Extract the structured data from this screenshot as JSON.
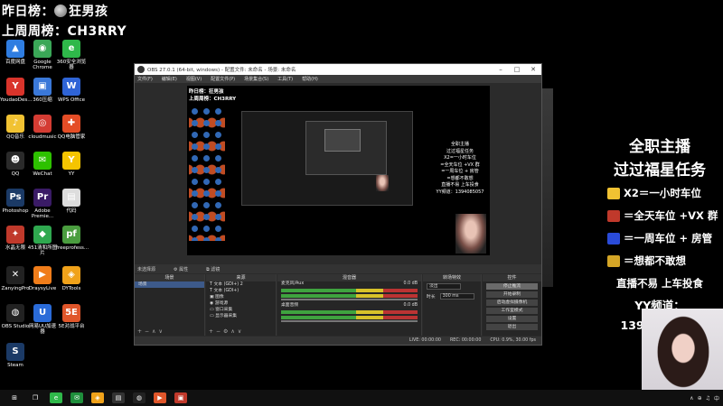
{
  "overlay": {
    "rank_yesterday": "昨日榜：",
    "rank_yesterday_name": "狂男孩",
    "rank_week": "上周周榜：",
    "rank_week_name": "CH3RRY"
  },
  "desktop_icons": [
    {
      "label": "百度网盘",
      "color": "#2f7de1",
      "glyph": "▲"
    },
    {
      "label": "Google Chrome",
      "color": "#3aa757",
      "glyph": "◉"
    },
    {
      "label": "360安全浏览器",
      "color": "#2fb84a",
      "glyph": "e"
    },
    {
      "label": "YoudaoDes...",
      "color": "#d9342b",
      "glyph": "Y"
    },
    {
      "label": "360压缩",
      "color": "#3a78d8",
      "glyph": "▣"
    },
    {
      "label": "WPS Office",
      "color": "#2f64d6",
      "glyph": "W"
    },
    {
      "label": "QQ音乐",
      "color": "#f1c232",
      "glyph": "♪"
    },
    {
      "label": "cloudmusic",
      "color": "#d43c33",
      "glyph": "◎"
    },
    {
      "label": "QQ电脑管家",
      "color": "#e44d26",
      "glyph": "✚"
    },
    {
      "label": "QQ",
      "color": "#2a2a2a",
      "glyph": "☻"
    },
    {
      "label": "WeChat",
      "color": "#2dc100",
      "glyph": "✉"
    },
    {
      "label": "YY",
      "color": "#f5c400",
      "glyph": "Y"
    },
    {
      "label": "Photoshop",
      "color": "#1b3a66",
      "glyph": "Ps"
    },
    {
      "label": "Adobe Premie...",
      "color": "#3a1b66",
      "glyph": "Pr"
    },
    {
      "label": "代码",
      "color": "#dddddd",
      "glyph": "▤"
    },
    {
      "label": "水晶无限",
      "color": "#c0392b",
      "glyph": "✦"
    },
    {
      "label": "451清和所图片",
      "color": "#2fa84f",
      "glyph": "◆"
    },
    {
      "label": "freeprofess...",
      "color": "#4a9d3f",
      "glyph": "pf"
    },
    {
      "label": "ZanyingPro",
      "color": "#222222",
      "glyph": "✕"
    },
    {
      "label": "DraysyLive",
      "color": "#f07d1a",
      "glyph": "▶"
    },
    {
      "label": "DYTools",
      "color": "#f0a21a",
      "glyph": "◈"
    },
    {
      "label": "OBS Studio",
      "color": "#222222",
      "glyph": "◍"
    },
    {
      "label": "网易UU加速器",
      "color": "#2a6bd8",
      "glyph": "U"
    },
    {
      "label": "5E对战平台",
      "color": "#e0562a",
      "glyph": "5E"
    },
    {
      "label": "Steam",
      "color": "#1b3a66",
      "glyph": "S"
    }
  ],
  "obs": {
    "title": "OBS 27.0.1 (64-bit, windows) - 配置文件: 未命名 - 场景: 未命名",
    "menu": [
      "文件(F)",
      "编辑(E)",
      "视图(V)",
      "配置文件(P)",
      "场景集合(S)",
      "工具(T)",
      "帮助(H)"
    ],
    "preview": {
      "rank_yesterday": "昨日榜：",
      "rank_yesterday_name": "狂男孩",
      "rank_week": "上周周榜：",
      "rank_week_name": "CH3RRY",
      "promo_title1": "全职主播",
      "promo_title2": "过过福星任务",
      "promo_items": [
        "X2=一小时车位",
        "=全天车位 +VX 群",
        "=一周车位 + 房管",
        "=想都不敢想"
      ],
      "promo_note": "直播不易 上车投食",
      "promo_yy": "YY频道：1394085057"
    },
    "source_bar_label": "未选择源",
    "props_label": "属性",
    "filters_label": "滤镜",
    "docks": {
      "scenes": {
        "header": "场景",
        "items": [
          "场景"
        ]
      },
      "sources": {
        "header": "来源",
        "items": [
          "文本 (GDI+) 2",
          "文本 (GDI+)",
          "图像",
          "游戏源",
          "窗口采集",
          "显示器采集"
        ]
      },
      "mixer": {
        "header": "混音器",
        "channels": [
          {
            "name": "麦克风/Aux",
            "db": "0.0 dB"
          },
          {
            "name": "桌面音频",
            "db": "0.0 dB"
          }
        ]
      },
      "transitions": {
        "header": "转场特效",
        "type": "淡出",
        "duration_label": "时长",
        "duration": "300 ms"
      },
      "controls": {
        "header": "控件",
        "buttons": [
          "停止推流",
          "开始录制",
          "启动虚拟摄像机",
          "工作室模式",
          "设置",
          "退出"
        ]
      }
    },
    "status": {
      "live": "LIVE: 00:00:00",
      "rec": "REC: 00:00:00",
      "cpu": "CPU: 0.9%, 30.00 fps"
    }
  },
  "right_overlay": {
    "title1": "全职主播",
    "title2": "过过福星任务",
    "items": [
      {
        "text": "X2＝一小时车位",
        "color": "#f1c232"
      },
      {
        "text": "＝全天车位 +VX 群",
        "color": "#c0392b"
      },
      {
        "text": "＝一周车位 + 房管",
        "color": "#2a4bd8"
      },
      {
        "text": "＝想都不敢想",
        "color": "#d4a526"
      }
    ],
    "note": "直播不易 上车投食",
    "yy": "YY频道：1394085057"
  },
  "taskbar": {
    "apps": [
      {
        "name": "windows-start",
        "color": "#101010",
        "glyph": "⊞"
      },
      {
        "name": "task-view",
        "color": "#101010",
        "glyph": "❐"
      },
      {
        "name": "360",
        "color": "#2fb84a",
        "glyph": "e"
      },
      {
        "name": "chat",
        "color": "#1f8f3c",
        "glyph": "✉"
      },
      {
        "name": "tool",
        "color": "#f0a21a",
        "glyph": "◈"
      },
      {
        "name": "terminal",
        "color": "#333333",
        "glyph": "▤"
      },
      {
        "name": "obs",
        "color": "#222222",
        "glyph": "◍"
      },
      {
        "name": "douyin",
        "color": "#e0562a",
        "glyph": "▶"
      },
      {
        "name": "pr",
        "color": "#c0392b",
        "glyph": "▣"
      }
    ],
    "tray": [
      "∧",
      "⊕",
      "♫",
      "中"
    ]
  }
}
